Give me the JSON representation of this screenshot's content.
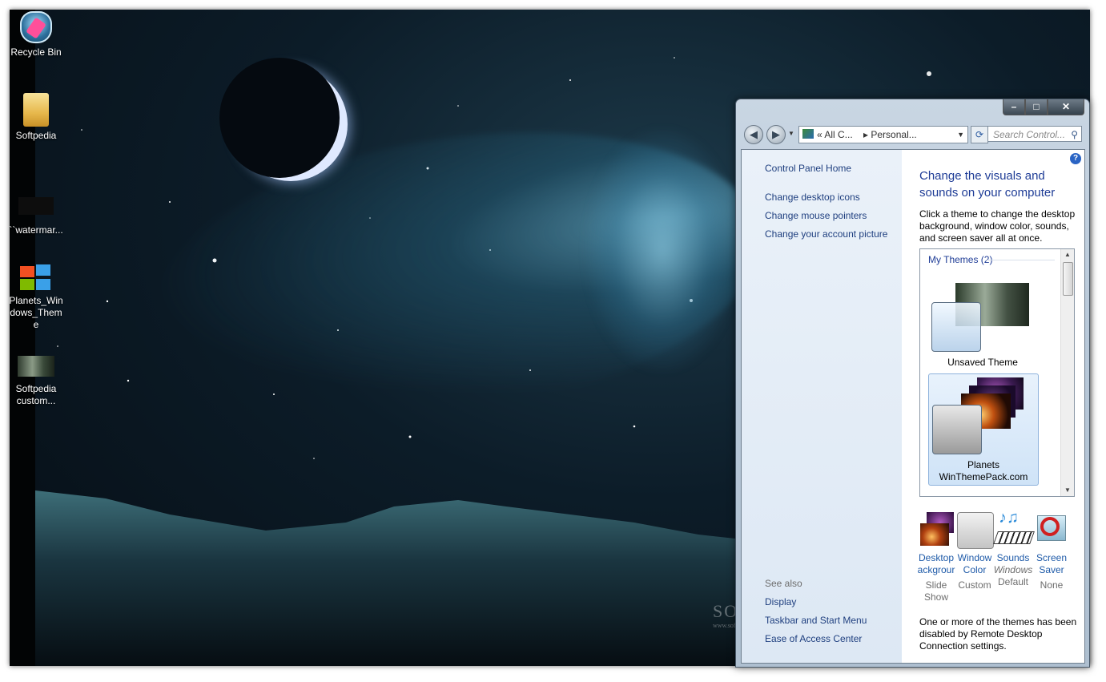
{
  "desktop": {
    "icons": [
      {
        "label": "Recycle Bin",
        "icon": "recycle-bin-icon"
      },
      {
        "label": "Softpedia",
        "icon": "folder-icon"
      },
      {
        "label": "``watermar...",
        "icon": "watermark-file-icon"
      },
      {
        "label": "Planets_Windows_Theme",
        "icon": "windows-logo-icon"
      },
      {
        "label": "Softpedia custom...",
        "icon": "image-thumbnail-icon"
      }
    ],
    "watermark": "SOFTPEDIA",
    "watermark_sub": "www.softpedia.com"
  },
  "window": {
    "caption": {
      "minimize": "–",
      "maximize": "□",
      "close": "✕"
    },
    "nav": {
      "back": "◀",
      "forward": "▶",
      "address": {
        "prefix": "«",
        "segment1": "All C...",
        "separator": "▸",
        "segment2": "Personal..."
      },
      "search_placeholder": "Search Control...",
      "search_icon": "magnifier-icon"
    },
    "left_pane": {
      "home": "Control Panel Home",
      "links": [
        "Change desktop icons",
        "Change mouse pointers",
        "Change your account picture"
      ],
      "see_also": "See also",
      "see_also_links": [
        "Display",
        "Taskbar and Start Menu",
        "Ease of Access Center"
      ]
    },
    "main": {
      "help": "?",
      "heading": "Change the visuals and sounds on your computer",
      "description": "Click a theme to change the desktop background, window color, sounds, and screen saver all at once.",
      "group": "My Themes (2)",
      "themes": [
        {
          "name": "Unsaved Theme",
          "selected": false
        },
        {
          "name": "Planets",
          "name2": "WinThemePack.com",
          "selected": true
        }
      ],
      "tiles": [
        {
          "label1": "Desktop",
          "label2": "ackgrour",
          "sub1": "Slide",
          "sub2": "Show"
        },
        {
          "label1": "Window",
          "label2": "Color",
          "sub1": "Custom",
          "sub2": ""
        },
        {
          "label1": "Sounds",
          "label2": "",
          "sub1": "Windows",
          "sub2": "Default"
        },
        {
          "label1": "Screen",
          "label2": "Saver",
          "sub1": "None",
          "sub2": ""
        }
      ],
      "note": "One or more of the themes has been disabled by Remote Desktop Connection settings."
    }
  },
  "colors": {
    "link": "#1f3f7f",
    "heading": "#1e3c96",
    "tile_label": "#1e5aa8"
  }
}
